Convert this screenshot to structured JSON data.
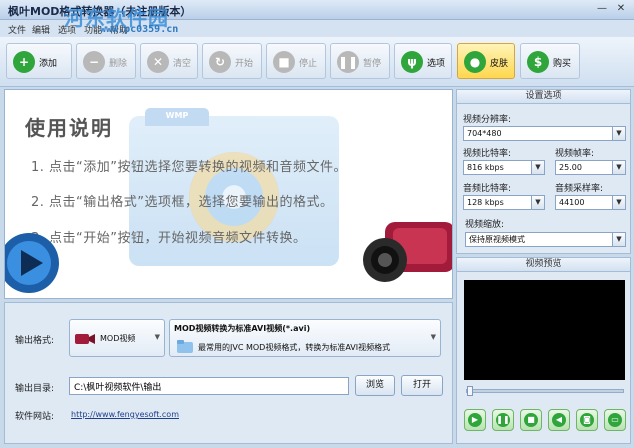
{
  "window": {
    "title": "枫叶MOD格式转换器（未注册版本）",
    "minimize": "—",
    "close": "✕"
  },
  "watermark": {
    "logo": "河东软件园",
    "url": "www.pc0359.cn"
  },
  "menu": [
    "文件",
    "编辑",
    "选项",
    "功能",
    "帮助"
  ],
  "toolbar": {
    "add": "添加",
    "remove": "删除",
    "clear": "清空",
    "start": "开始",
    "stop": "停止",
    "pause": "暂停",
    "options": "选项",
    "skin": "皮肤",
    "buy": "购买"
  },
  "instructions": {
    "title": "使用说明",
    "folder_tag": "WMP",
    "lines": [
      "1. 点击“添加”按钮选择您要转换的视频和音频文件。",
      "2. 点击“输出格式”选项框，选择您要输出的格式。",
      "3. 点击“开始”按钮，开始视频音频文件转换。"
    ]
  },
  "output": {
    "format_label": "输出格式:",
    "format_value": "MOD视频",
    "format_title": "MOD视频转换为标准AVI视频(*.avi)",
    "format_desc": "最常用的JVC MOD视频格式，转换为标准AVI视频格式",
    "dir_label": "输出目录:",
    "dir_value": "C:\\枫叶视频软件\\输出",
    "browse": "浏览",
    "open": "打开",
    "site_label": "软件网站:",
    "site_url": "http://www.fengyesoft.com"
  },
  "settings": {
    "title": "设置选项",
    "resolution_label": "视频分辨率:",
    "resolution": "704*480",
    "vbitrate_label": "视频比特率:",
    "vbitrate": "816 kbps",
    "fps_label": "视频帧率:",
    "fps": "25.00",
    "abitrate_label": "音频比特率:",
    "abitrate": "128 kbps",
    "samplerate_label": "音频采样率:",
    "samplerate": "44100",
    "scale_label": "视频缩放:",
    "scale": "保持原视频模式"
  },
  "preview": {
    "title": "视频预览"
  },
  "colors": {
    "accent": "#3b8ed8",
    "play_green": "#2fa53b",
    "highlight": "#ffd74e"
  }
}
